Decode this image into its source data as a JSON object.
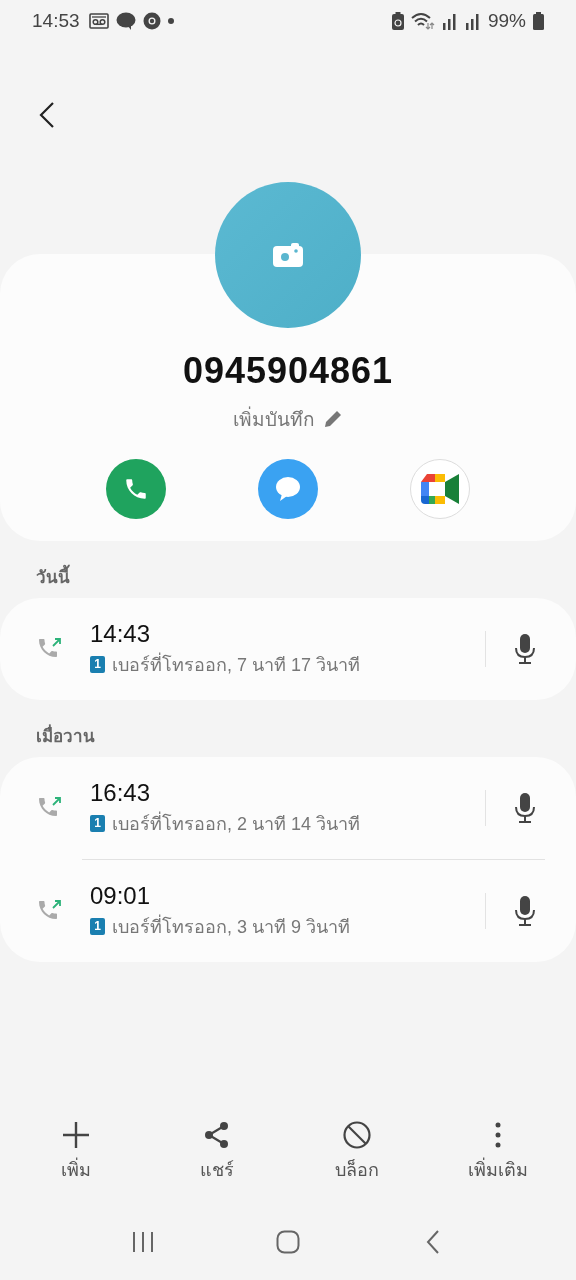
{
  "status_bar": {
    "time": "14:53",
    "battery": "99%"
  },
  "contact": {
    "number": "0945904861",
    "note_link": "เพิ่มบันทึก"
  },
  "actions": [
    {
      "kind": "call"
    },
    {
      "kind": "message"
    },
    {
      "kind": "video"
    }
  ],
  "history": [
    {
      "heading": "วันนี้",
      "calls": [
        {
          "time": "14:43",
          "sim": "1",
          "detail": "เบอร์ที่โทรออก, 7 นาที 17 วินาที",
          "kind": "outgoing"
        }
      ]
    },
    {
      "heading": "เมื่อวาน",
      "calls": [
        {
          "time": "16:43",
          "sim": "1",
          "detail": "เบอร์ที่โทรออก, 2 นาที 14 วินาที",
          "kind": "outgoing"
        },
        {
          "time": "09:01",
          "sim": "1",
          "detail": "เบอร์ที่โทรออก, 3 นาที 9 วินาที",
          "kind": "outgoing"
        }
      ]
    }
  ],
  "bottom_actions": [
    {
      "label": "เพิ่ม",
      "kind": "add"
    },
    {
      "label": "แชร์",
      "kind": "share"
    },
    {
      "label": "บล็อก",
      "kind": "block"
    },
    {
      "label": "เพิ่มเติม",
      "kind": "more"
    }
  ]
}
